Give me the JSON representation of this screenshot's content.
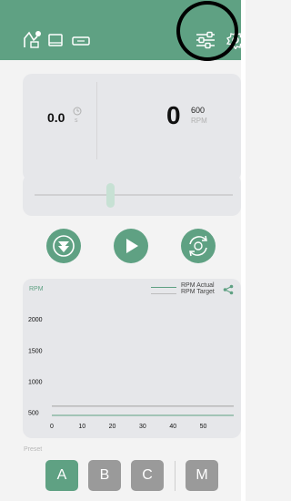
{
  "header": {
    "icons": [
      "robot-icon",
      "monitor-icon",
      "ticket-icon",
      "sliders-icon",
      "gear-icon"
    ]
  },
  "status": {
    "time_value": "0.0",
    "time_unit": "s",
    "rpm_value": "0",
    "rpm_setpoint": "600",
    "rpm_unit": "RPM"
  },
  "slider": {
    "level": 0.38
  },
  "controls": {
    "icons": [
      "chevron-down-double-icon",
      "play-icon",
      "refresh-icon"
    ],
    "color": "#5fa183"
  },
  "chart_data": {
    "type": "line",
    "ylabel": "RPM",
    "xlabel": "",
    "x_ticks": [
      "0",
      "10",
      "20",
      "30",
      "40",
      "50"
    ],
    "y_ticks": [
      "2000",
      "1500",
      "1000",
      "500"
    ],
    "xlim": [
      0,
      60
    ],
    "ylim": [
      450,
      2150
    ],
    "legend_position": "top-right",
    "series": [
      {
        "name": "RPM Actual",
        "color": "#5fa183",
        "x": [
          0,
          60
        ],
        "y": [
          0,
          0
        ]
      },
      {
        "name": "RPM Target",
        "color": "#bdbdbd",
        "x": [
          0,
          60
        ],
        "y": [
          600,
          600
        ]
      }
    ],
    "share_icon": "share-icon"
  },
  "preset": {
    "label": "Preset",
    "buttons": [
      {
        "label": "A",
        "color": "#5fa183",
        "selected": true
      },
      {
        "label": "B",
        "color": "#9a9a9a",
        "selected": false
      },
      {
        "label": "C",
        "color": "#9a9a9a",
        "selected": false
      },
      {
        "label": "M",
        "color": "#9a9a9a",
        "selected": false
      }
    ]
  }
}
